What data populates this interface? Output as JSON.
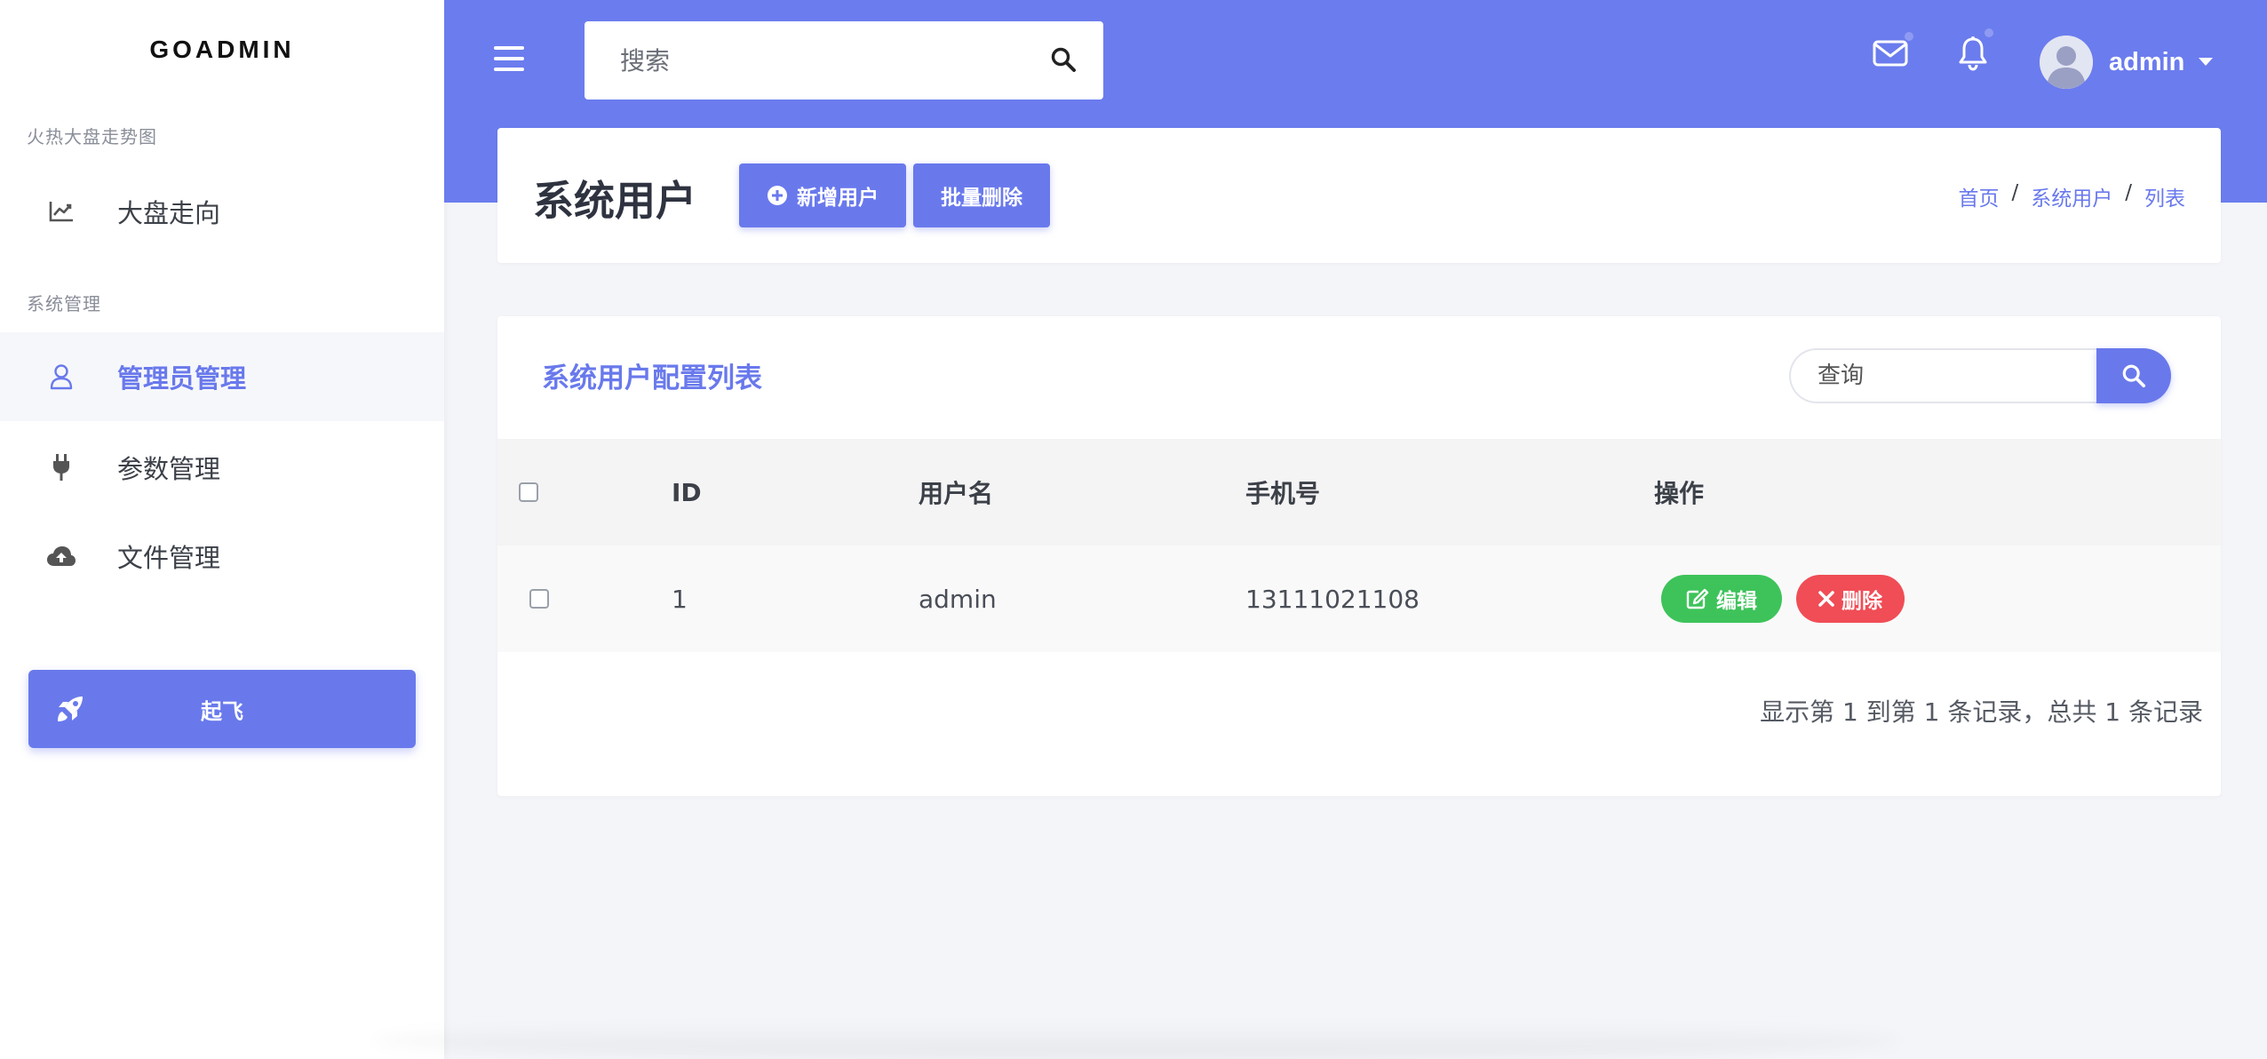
{
  "colors": {
    "accent": "#6979ec",
    "header_bg": "#6b7cee",
    "success": "#3ec35a",
    "danger": "#f04d56",
    "page_bg": "#f4f5f9"
  },
  "sidebar": {
    "logo": "GOADMIN",
    "sections": [
      {
        "label": "火热大盘走势图",
        "items": [
          {
            "label": "大盘走向",
            "icon": "line-chart-icon",
            "active": false
          }
        ]
      },
      {
        "label": "系统管理",
        "items": [
          {
            "label": "管理员管理",
            "icon": "user-icon",
            "active": true
          },
          {
            "label": "参数管理",
            "icon": "plug-icon",
            "active": false
          },
          {
            "label": "文件管理",
            "icon": "cloud-upload-icon",
            "active": false
          }
        ]
      }
    ],
    "launch_button": {
      "label": "起飞",
      "icon": "rocket-icon"
    }
  },
  "header": {
    "menu_icon": "hamburger-icon",
    "search": {
      "placeholder": "搜索",
      "value": "",
      "icon": "search-icon"
    },
    "mail_icon": "envelope-icon",
    "bell_icon": "bell-icon",
    "user": {
      "name": "admin",
      "avatar_icon": "avatar-icon",
      "caret_icon": "caret-down-icon"
    }
  },
  "page": {
    "title": "系统用户",
    "add_button": "新增用户",
    "batch_delete_button": "批量删除",
    "breadcrumb": [
      "首页",
      "系统用户",
      "列表"
    ]
  },
  "table_card": {
    "title": "系统用户配置列表",
    "search_placeholder": "查询",
    "columns": [
      "ID",
      "用户名",
      "手机号",
      "操作"
    ],
    "rows": [
      {
        "id": "1",
        "username": "admin",
        "phone": "13111021108",
        "edit_label": "编辑",
        "delete_label": "删除"
      }
    ],
    "pagination": "显示第 1 到第 1 条记录，总共 1 条记录"
  }
}
